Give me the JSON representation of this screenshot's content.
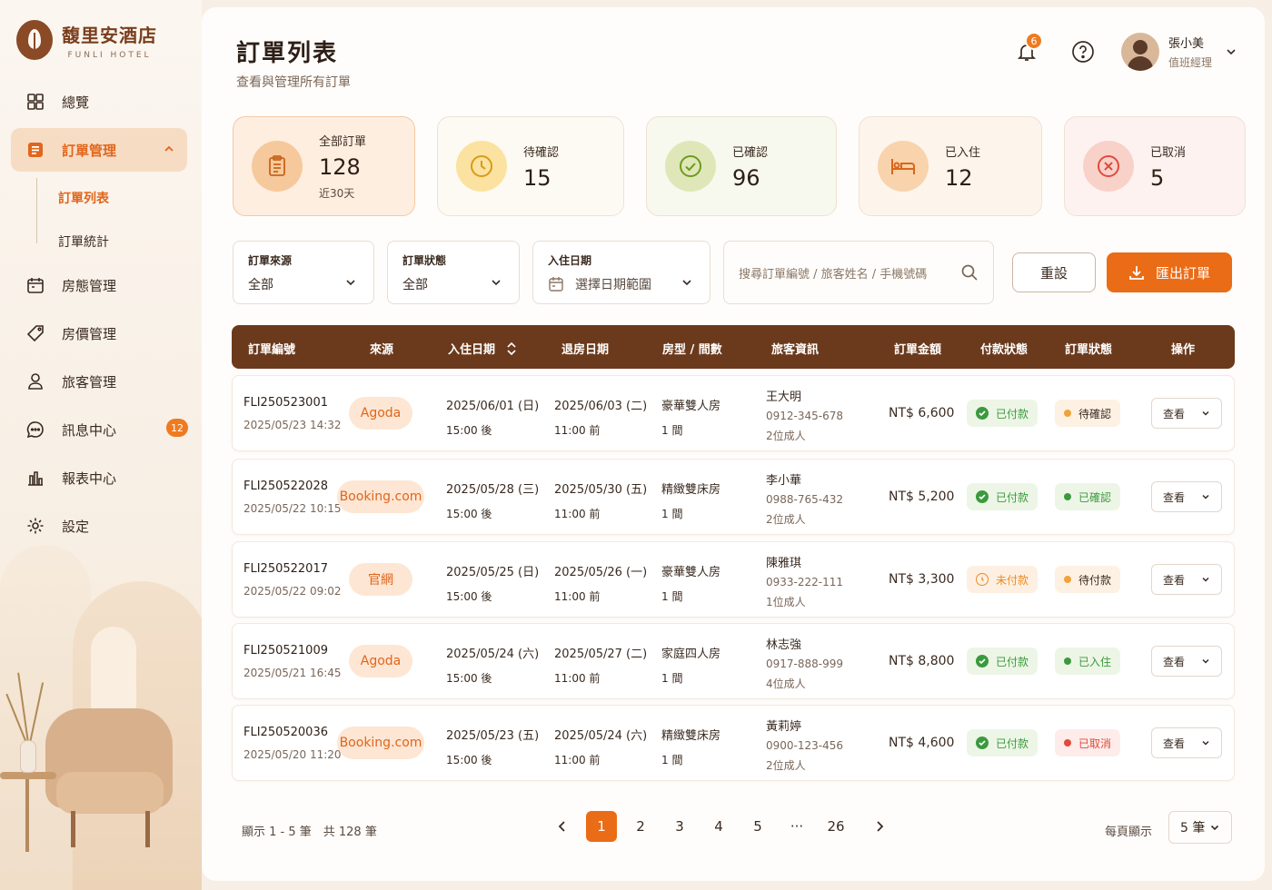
{
  "brand": {
    "name": "馥里安酒店",
    "sub": "FUNLI HOTEL"
  },
  "nav": {
    "items": [
      {
        "label": "總覽",
        "icon": "dashboard-icon"
      },
      {
        "label": "訂單管理",
        "icon": "orders-icon"
      },
      {
        "label": "房態管理",
        "icon": "calendar-icon"
      },
      {
        "label": "房價管理",
        "icon": "price-tag-icon"
      },
      {
        "label": "旅客管理",
        "icon": "user-icon"
      },
      {
        "label": "訊息中心",
        "icon": "chat-icon",
        "badge": "12"
      },
      {
        "label": "報表中心",
        "icon": "chart-icon"
      },
      {
        "label": "設定",
        "icon": "gear-icon"
      }
    ],
    "subitems": [
      {
        "label": "訂單列表"
      },
      {
        "label": "訂單統計"
      }
    ]
  },
  "header": {
    "title": "訂單列表",
    "subtitle": "查看與管理所有訂單",
    "notif_count": "6",
    "user_name": "張小美",
    "user_role": "值班經理"
  },
  "stats": [
    {
      "label": "全部訂單",
      "value": "128",
      "note": "近30天",
      "icon": "clipboard-icon",
      "color": "#f0a45a"
    },
    {
      "label": "待確認",
      "value": "15",
      "icon": "clock-icon",
      "color": "#f0c04a"
    },
    {
      "label": "已確認",
      "value": "96",
      "icon": "check-circle-icon",
      "color": "#8dad3a"
    },
    {
      "label": "已入住",
      "value": "12",
      "icon": "bed-icon",
      "color": "#ee9a4a"
    },
    {
      "label": "已取消",
      "value": "5",
      "icon": "x-circle-icon",
      "color": "#e8685a"
    }
  ],
  "filters": {
    "source": {
      "label": "訂單來源",
      "value": "全部"
    },
    "status": {
      "label": "訂單狀態",
      "value": "全部"
    },
    "checkin": {
      "label": "入住日期",
      "value": "選擇日期範圍"
    },
    "search_placeholder": "搜尋訂單編號 / 旅客姓名 / 手機號碼",
    "reset": "重設",
    "export": "匯出訂單"
  },
  "table": {
    "headers": [
      "訂單編號",
      "來源",
      "入住日期",
      "退房日期",
      "房型 / 間數",
      "旅客資訊",
      "訂單金額",
      "付款狀態",
      "訂單狀態",
      "操作"
    ],
    "rows": [
      {
        "id": "FLI250523001",
        "created": "2025/05/23 14:32",
        "source": "Agoda",
        "checkin": "2025/06/01 (日)",
        "checkin_time": "15:00 後",
        "checkout": "2025/06/03 (二)",
        "checkout_time": "11:00 前",
        "room": "豪華雙人房",
        "qty": "1 間",
        "guest": "王大明",
        "phone": "0912-345-678",
        "people": "2位成人",
        "amount": "NT$ 6,600",
        "pay": "已付款",
        "pay_kind": "paid",
        "status": "待確認",
        "status_kind": "pending",
        "action": "查看"
      },
      {
        "id": "FLI250522028",
        "created": "2025/05/22 10:15",
        "source": "Booking.com",
        "checkin": "2025/05/28 (三)",
        "checkin_time": "15:00 後",
        "checkout": "2025/05/30 (五)",
        "checkout_time": "11:00 前",
        "room": "精緻雙床房",
        "qty": "1 間",
        "guest": "李小華",
        "phone": "0988-765-432",
        "people": "2位成人",
        "amount": "NT$ 5,200",
        "pay": "已付款",
        "pay_kind": "paid",
        "status": "已確認",
        "status_kind": "confirmed",
        "action": "查看"
      },
      {
        "id": "FLI250522017",
        "created": "2025/05/22 09:02",
        "source": "官網",
        "checkin": "2025/05/25 (日)",
        "checkin_time": "15:00 後",
        "checkout": "2025/05/26 (一)",
        "checkout_time": "11:00 前",
        "room": "豪華雙人房",
        "qty": "1 間",
        "guest": "陳雅琪",
        "phone": "0933-222-111",
        "people": "1位成人",
        "amount": "NT$ 3,300",
        "pay": "未付款",
        "pay_kind": "unpaid",
        "status": "待付款",
        "status_kind": "pending",
        "action": "查看"
      },
      {
        "id": "FLI250521009",
        "created": "2025/05/21 16:45",
        "source": "Agoda",
        "checkin": "2025/05/24 (六)",
        "checkin_time": "15:00 後",
        "checkout": "2025/05/27 (二)",
        "checkout_time": "11:00 前",
        "room": "家庭四人房",
        "qty": "1 間",
        "guest": "林志強",
        "phone": "0917-888-999",
        "people": "4位成人",
        "amount": "NT$ 8,800",
        "pay": "已付款",
        "pay_kind": "paid",
        "status": "已入住",
        "status_kind": "confirmed",
        "action": "查看"
      },
      {
        "id": "FLI250520036",
        "created": "2025/05/20 11:20",
        "source": "Booking.com",
        "checkin": "2025/05/23 (五)",
        "checkin_time": "15:00 後",
        "checkout": "2025/05/24 (六)",
        "checkout_time": "11:00 前",
        "room": "精緻雙床房",
        "qty": "1 間",
        "guest": "黃莉婷",
        "phone": "0900-123-456",
        "people": "2位成人",
        "amount": "NT$ 4,600",
        "pay": "已付款",
        "pay_kind": "paid",
        "status": "已取消",
        "status_kind": "cancelled",
        "action": "查看"
      }
    ]
  },
  "pagination": {
    "info": "顯示 1 - 5 筆　共 128 筆",
    "pages": [
      "1",
      "2",
      "3",
      "4",
      "5",
      "···",
      "26"
    ],
    "current": "1",
    "per_page_label": "每頁顯示",
    "per_page": "5 筆"
  },
  "colors": {
    "accent": "#ea6c16",
    "header_bg": "#6b3a1c",
    "paid": "#3b9a3e",
    "unpaid": "#ef8a1f",
    "cancelled": "#e04a3a"
  }
}
